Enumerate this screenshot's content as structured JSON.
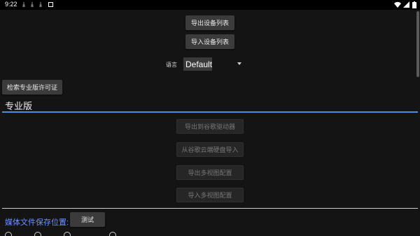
{
  "status_bar": {
    "time": "9:22"
  },
  "buttons": {
    "export_device_list": "导出设备列表",
    "import_device_list": "导入设备列表",
    "retrieve_license": "检索专业版许可证",
    "export_google_drive": "导出到谷歌驱动器",
    "import_google_drive": "从谷歌云端硬盘导入",
    "export_multiview": "导出多视图配置",
    "import_multiview": "导入多视图配置",
    "test": "测试"
  },
  "language": {
    "label": "语言",
    "selected": "Default"
  },
  "pro_section": {
    "title": "专业版"
  },
  "media": {
    "label": "媒体文件保存位置:"
  },
  "colors": {
    "accent": "#4a90e2",
    "label_blue": "#6f8fff"
  }
}
